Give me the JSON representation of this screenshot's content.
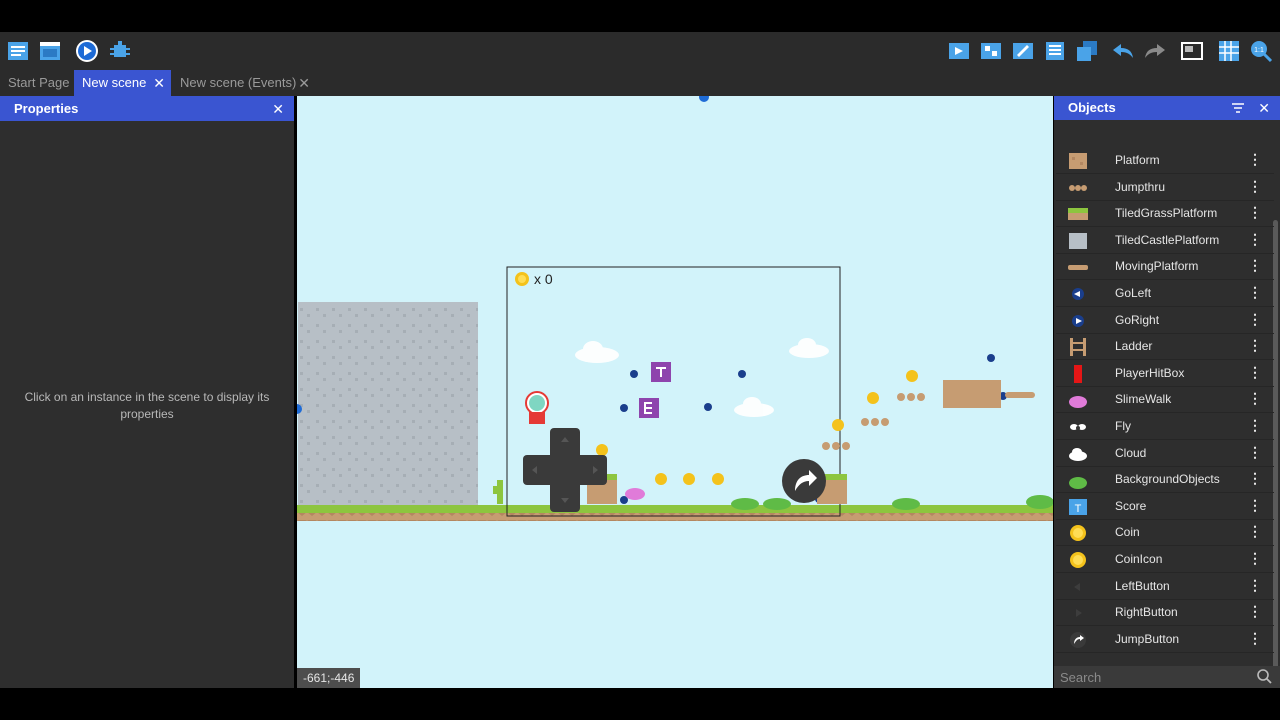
{
  "tabs": [
    {
      "label": "Start Page"
    },
    {
      "label": "New scene"
    },
    {
      "label": "New scene (Events)"
    }
  ],
  "properties": {
    "title": "Properties",
    "hint": "Click on an instance in the scene to display its properties"
  },
  "scene": {
    "hud_score": "x 0",
    "cursor_coords": "-661;-446"
  },
  "objects": {
    "title": "Objects",
    "items": [
      {
        "label": "Platform",
        "icon": "platform-icon"
      },
      {
        "label": "Jumpthru",
        "icon": "jumpthru-icon"
      },
      {
        "label": "TiledGrassPlatform",
        "icon": "grass-platform-icon"
      },
      {
        "label": "TiledCastlePlatform",
        "icon": "castle-platform-icon"
      },
      {
        "label": "MovingPlatform",
        "icon": "moving-platform-icon"
      },
      {
        "label": "GoLeft",
        "icon": "go-left-icon"
      },
      {
        "label": "GoRight",
        "icon": "go-right-icon"
      },
      {
        "label": "Ladder",
        "icon": "ladder-icon"
      },
      {
        "label": "PlayerHitBox",
        "icon": "hitbox-icon"
      },
      {
        "label": "SlimeWalk",
        "icon": "slime-icon"
      },
      {
        "label": "Fly",
        "icon": "fly-icon"
      },
      {
        "label": "Cloud",
        "icon": "cloud-icon"
      },
      {
        "label": "BackgroundObjects",
        "icon": "bg-objects-icon"
      },
      {
        "label": "Score",
        "icon": "score-icon"
      },
      {
        "label": "Coin",
        "icon": "coin-icon"
      },
      {
        "label": "CoinIcon",
        "icon": "coin-icon"
      },
      {
        "label": "LeftButton",
        "icon": "left-button-icon"
      },
      {
        "label": "RightButton",
        "icon": "right-button-icon"
      },
      {
        "label": "JumpButton",
        "icon": "jump-button-icon"
      }
    ],
    "search_placeholder": "Search"
  }
}
